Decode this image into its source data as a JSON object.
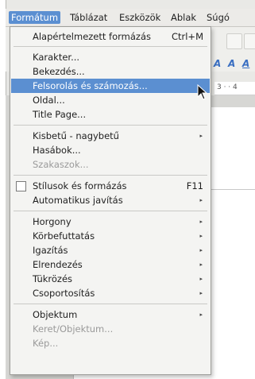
{
  "menubar": {
    "items": [
      {
        "label": "Formátum",
        "active": true
      },
      {
        "label": "Táblázat"
      },
      {
        "label": "Eszközök"
      },
      {
        "label": "Ablak"
      },
      {
        "label": "Súgó"
      }
    ]
  },
  "ruler": {
    "label": "3 · · 4"
  },
  "menu": {
    "default_format": {
      "label": "Alapértelmezett formázás",
      "shortcut": "Ctrl+M"
    },
    "character": "Karakter...",
    "paragraph": "Bekezdés...",
    "bullets_numbering": "Felsorolás és számozás...",
    "page": "Oldal...",
    "title_page": "Title Page...",
    "change_case": "Kisbetű - nagybetű",
    "columns": "Hasábok...",
    "sections": "Szakaszok...",
    "styles_formatting": {
      "label": "Stílusok és formázás",
      "shortcut": "F11",
      "checked": false
    },
    "autocorrect": "Automatikus javítás",
    "anchor": "Horgony",
    "wrap": "Körbefuttatás",
    "alignment": "Igazítás",
    "arrange": "Elrendezés",
    "flip": "Tükrözés",
    "group": "Csoportosítás",
    "object": "Objektum",
    "frame_object": "Keret/Objektum...",
    "image": "Kép..."
  },
  "colors": {
    "highlight": "#5b8fd1",
    "menu_bg": "#f4f4f2"
  }
}
